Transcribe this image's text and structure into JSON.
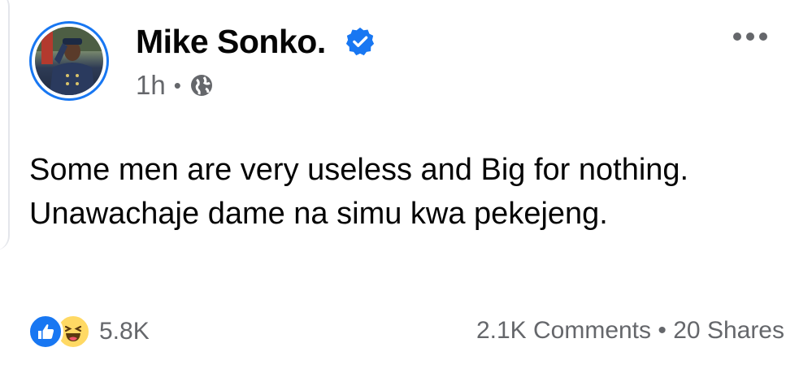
{
  "post": {
    "author": "Mike Sonko.",
    "time": "1h",
    "separator": "•",
    "text": "Some men are very useless and Big for nothing. Unawachaje dame na simu kwa pekejeng.",
    "audience_icon": "globe-icon",
    "verified_icon": "verified-badge-icon"
  },
  "reactions": {
    "icons": [
      "like-reaction-icon",
      "haha-reaction-icon"
    ],
    "count": "5.8K"
  },
  "engagement": {
    "comments": "2.1K Comments",
    "separator": "•",
    "shares": "20 Shares"
  },
  "colors": {
    "accent": "#1877f2",
    "secondary_text": "#65676b",
    "primary_text": "#050505",
    "haha": "#ffd964"
  }
}
